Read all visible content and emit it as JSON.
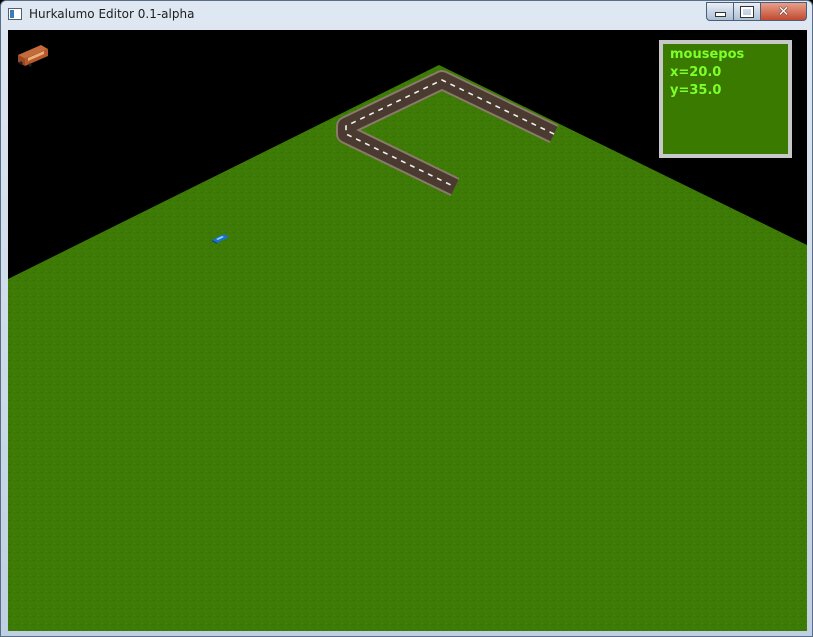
{
  "window": {
    "title": "Hurkalumo Editor 0.1-alpha",
    "minimize_glyph": "—",
    "maximize_glyph": "□",
    "close_glyph": "✕"
  },
  "hud": {
    "title": "mousepos",
    "x_label": "x=20.0",
    "y_label": "y=35.0"
  },
  "colors": {
    "background": "#000000",
    "grass": "#3d7a06",
    "road": "#4a3a30",
    "road_edge": "#8a7a6a",
    "road_dash": "#f0f0f0",
    "hud_bg": "#3a7a00",
    "hud_border": "#c8c8c8",
    "hud_text": "#7dff2a"
  },
  "tools": {
    "selected_tile_icon": "bus-icon"
  },
  "scene": {
    "vehicles": [
      "car-icon"
    ]
  }
}
